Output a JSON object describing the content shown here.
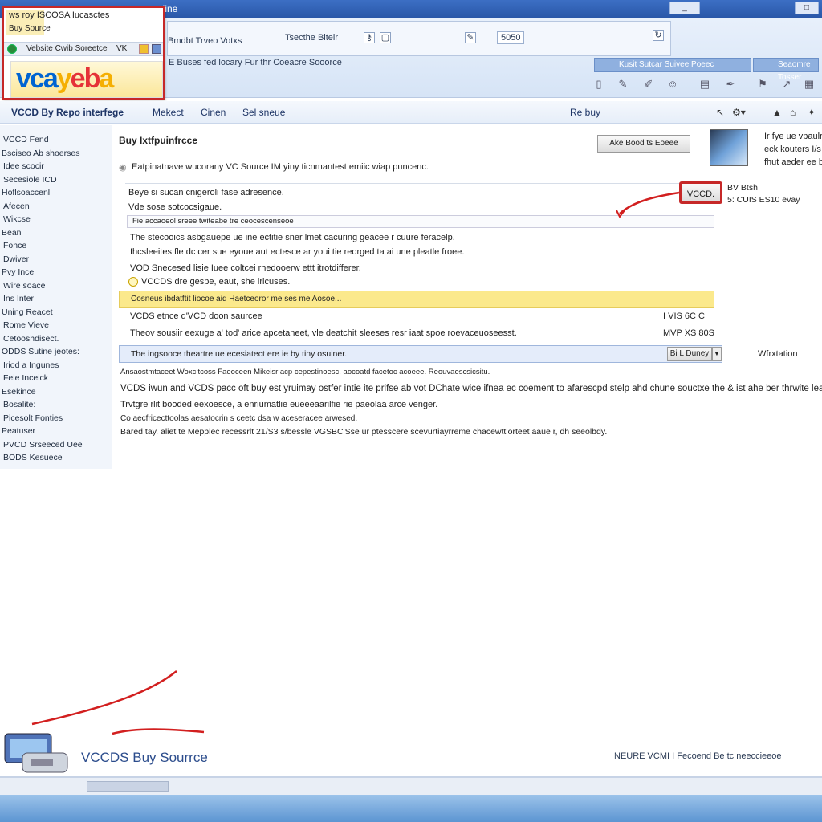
{
  "window": {
    "title": "aline",
    "buttons": [
      "_",
      "□"
    ]
  },
  "browser": {
    "address_left": "Bmdbt Trveo Votxs",
    "address_mid": "Tsecthe Biteir",
    "address_right": "5050",
    "promo": "E Buses fed locary Fur thr Coeacre Sooorce",
    "tools_left": "Kusit Sutcar Suivee Poeec",
    "tools_right": "Seaomre Tosser"
  },
  "popup": {
    "line1": "ws roy ISCOSA Iucasctes",
    "line2": "Buy Source",
    "bar_label": "Vebsite Cwib Soreetce",
    "bar_right": "VK",
    "logo": {
      "part1": "vca",
      "part2": "y",
      "part3": "eb",
      "part4": "a"
    }
  },
  "header": {
    "app_title": "VCCD By Repo interfege",
    "nav1": "Mekect",
    "nav2": "Cinen",
    "nav3": "Sel sneue",
    "right": "Re buy"
  },
  "sidebar": {
    "items": [
      "VCCD Fend",
      "Bsciseo Ab shoerses",
      "Idee scocir",
      "Secesiole ICD",
      "Hoflsoaccenl",
      "Afecen",
      "Wikcse",
      "Bean",
      "Fonce",
      "Dwiver",
      "Pvy Ince",
      "Wire soace",
      "Ins Inter",
      "Uning Reacet",
      "Rome Vieve",
      "Cetooshdisect.",
      "ODDS Sutine jeotes:",
      "Iriod a Ingunes",
      "Feie Inceick",
      "Esekince",
      "Bosalite:",
      "Picesolt Fonties",
      "Peatuser",
      "PVCD Srseeced Uee",
      "BODS Kesuece"
    ]
  },
  "main": {
    "title": "Buy Ixtfpuinfrcce",
    "top_button": "Ake Bood ts Eoeee",
    "intro": "Eatpinatnave wucorany VC Source IM yiny ticnmantest emiic wiap puncenc.",
    "box_line1": "Beye si sucan cnigeroli fase adresence.",
    "box_line2": "Vde sose sotcocsigaue.",
    "box_line3": "Fie accaoeol sreee twiteabe tre ceocescenseoe",
    "para1": "The stecooics asbgauepe ue ine ectitie sner lmet cacuring geacee r cuure feracelp.",
    "para2": "Ihcsleeites fle dc cer sue eyoue aut ectesce ar youi tie reorged ta ai une pleatle froee.",
    "para3": "VOD Snecesed lisie Iuee coltcei rhedooerw ettt itrotdifferer.",
    "radio_label": "VCCDS dre gespe, eaut, she iricuses.",
    "highlight": "Cosneus ibdatftit liocoe aid Haetceoror me ses me Aosoe...",
    "row1": "VCDS etnce d'VCD doon saurcee",
    "row1_right": "I VIS 6C C",
    "row2": "Theov sousiir eexuge a' tod' arice apcetaneet, vle deatchit sleeses resr iaat spoe roevaceuoseesst.",
    "row2_right": "MVP XS 80S",
    "blue_row": "The ingsooce theartre ue ecesiatect ere ie by tiny osuiner.",
    "blue_btn": "Bi L Duney",
    "blue_right": "Wfrxtation",
    "small_line": "Ansaostmtaceet Woxcitcoss Faeoceen Mikeisr acp cepestinoesc, aocoatd facetoc acoeee. Reouvaescsicsitu.",
    "body1": "VCDS iwun and VCDS pacc oft buy est yruimay ostfer intie ite prifse ab vot DChate wice ifnea ec coement to afarescpd stelp ahd chune souctxe the & ist ahe ber thrwite leat.",
    "body2": "Trvtgre rlit booded eexoesce, a enriumatlie eueeeaarilfie rie paeolaa arce venger.",
    "body3": "Co aecfricecttoolas aesatocrin s ceetc dsa w aceseracee arwesed.",
    "body4": "Bared tay. aliet te Mepplec recessrlt 21/S3 s/bessle VGSBC'Sse ur ptesscere scevurtiayrreme chacewttiorteet aaue r, dh seeolbdy."
  },
  "right_panel": {
    "text1": "Ir fye ue vpaulr",
    "text2": "eck kouters I/s",
    "text3": "fhut aeder ee b/s",
    "vccd_btn": "VCCD.",
    "side1": "BV Btsh",
    "side2": "5: CUIS ES10 evay"
  },
  "footer": {
    "title": "VCCDS Buy Sourrce",
    "right": "NEURE VCMI I Fecoend Be tc neeccieeoe"
  },
  "colors": {
    "accent": "#3c6fc4",
    "highlight": "#fbe98c",
    "annotation": "#c62828",
    "sidebar_bg": "#f1f5fb"
  }
}
